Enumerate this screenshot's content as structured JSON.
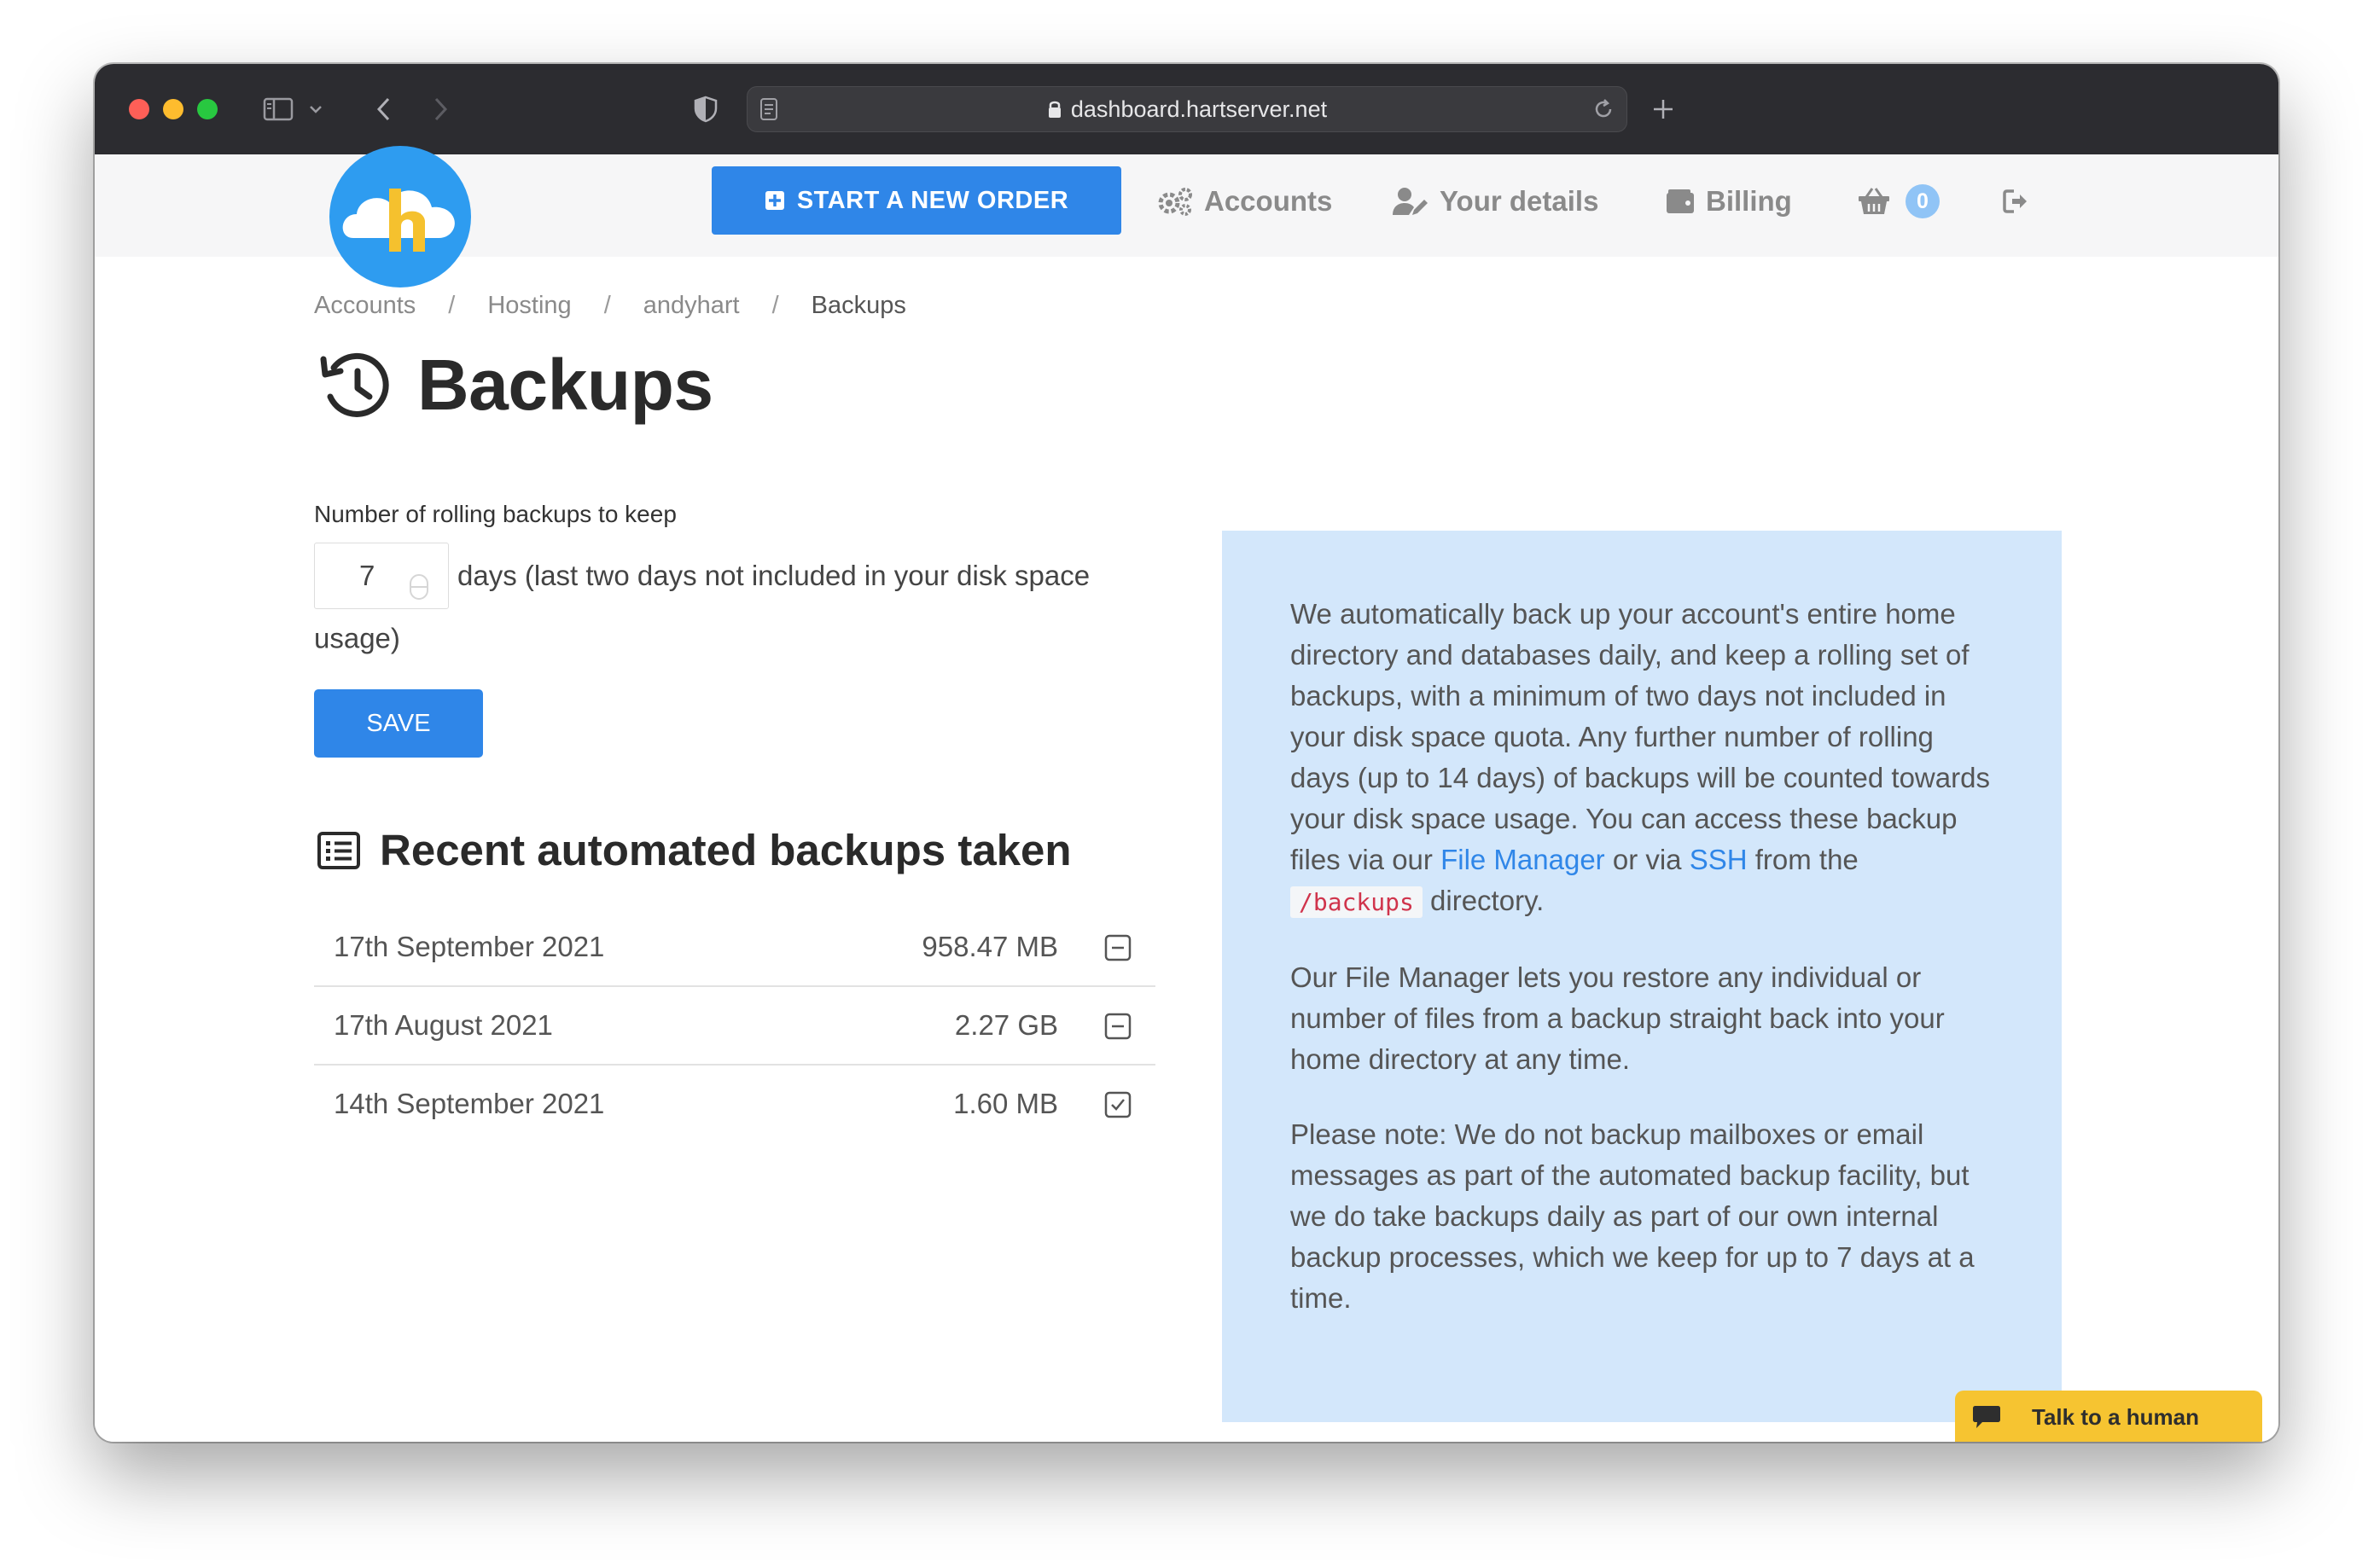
{
  "browser": {
    "url": "dashboard.hartserver.net"
  },
  "nav": {
    "order_button": "START A NEW ORDER",
    "accounts": "Accounts",
    "your_details": "Your details",
    "billing": "Billing",
    "cart_count": "0"
  },
  "logo": {
    "letter": "h"
  },
  "breadcrumb": {
    "items": [
      "Accounts",
      "Hosting",
      "andyhart",
      "Backups"
    ],
    "separator": "/"
  },
  "page": {
    "title": "Backups"
  },
  "form": {
    "label": "Number of rolling backups to keep",
    "value": "7",
    "suffix": "days (last two days not included in your disk space usage)",
    "save_label": "SAVE"
  },
  "recent": {
    "title": "Recent automated backups taken",
    "rows": [
      {
        "date": "17th September 2021",
        "size": "958.47 MB",
        "status": "minus-square-icon"
      },
      {
        "date": "17th August 2021",
        "size": "2.27 GB",
        "status": "minus-square-icon"
      },
      {
        "date": "14th September 2021",
        "size": "1.60 MB",
        "status": "check-square-icon"
      }
    ]
  },
  "info": {
    "p1_a": "We automatically back up your account's entire home directory and databases daily, and keep a rolling set of backups, with a minimum of two days not included in your disk space quota. Any further number of rolling days (up to 14 days) of backups will be counted towards your disk space usage. You can access these backup files via our ",
    "p1_link1": "File Manager",
    "p1_b": " or via ",
    "p1_link2": "SSH",
    "p1_c": " from the ",
    "p1_code": "/backups",
    "p1_d": " directory.",
    "p2": "Our File Manager lets you restore any individual or number of files from a backup straight back into your home directory at any time.",
    "p3": "Please note: We do not backup mailboxes or email messages as part of the automated backup facility, but we do take backups daily as part of our own internal backup processes, which we keep for up to 7 days at a time."
  },
  "chat": {
    "label": "Talk to a human"
  },
  "colors": {
    "primary": "#2f86e8",
    "info_bg": "#d3e7fb",
    "chat": "#f6c431",
    "logo": "#2e9cf0",
    "logo_letter": "#f5c12e"
  }
}
